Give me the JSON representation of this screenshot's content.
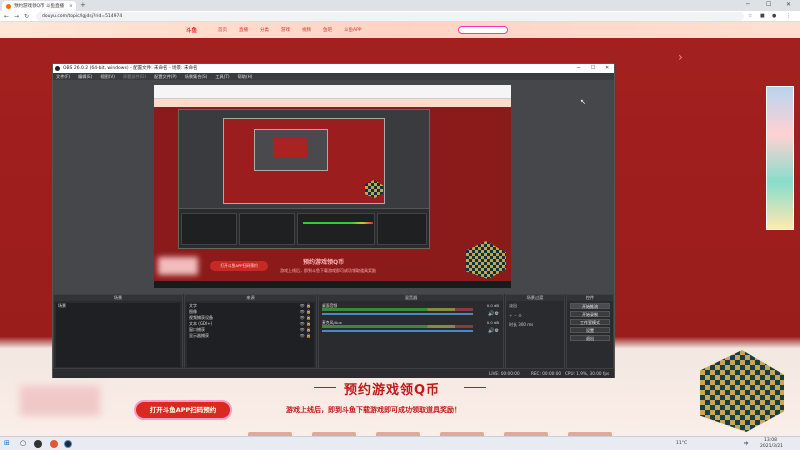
{
  "browser": {
    "tab_title": "预约游戏领Q币 斗鱼直播",
    "tab_close": "×",
    "new_tab": "+",
    "minimize": "─",
    "maximize": "☐",
    "close": "✕",
    "address": "douyu.com/topic/lgjdsj?rid=514974",
    "back": "←",
    "forward": "→",
    "reload": "↻",
    "star": "☆"
  },
  "site": {
    "logo": "斗鱼",
    "nav": [
      "首页",
      "直播",
      "分类",
      "游戏",
      "视频",
      "鱼吧",
      "斗鱼APP"
    ],
    "banner_title": "预约游戏领Q币",
    "banner_sub": "游戏上线后，即到斗鱼下载游戏即可成功领取道具奖励！",
    "app_button": "打开斗鱼APP扫码预约"
  },
  "obs": {
    "title": "OBS 26.0.2 (64-bit, windows) - 配置文件: 未命名 - 场景: 未命名",
    "menu": [
      "文件(F)",
      "编辑(E)",
      "视图(V)",
      "停靠部件(D)",
      "配置文件(P)",
      "场景集合(S)",
      "工具(T)",
      "帮助(H)"
    ],
    "canvas": {
      "banner": "预约游戏领Q币",
      "subtitle": "游戏上线后，即到斗鱼下载游戏即可成功领取道具奖励",
      "button": "打开斗鱼APP扫码预约"
    },
    "docks": {
      "scenes": {
        "header": "场景",
        "items": [
          "场景"
        ],
        "footer": "+ − ∧ ∨"
      },
      "sources": {
        "header": "来源",
        "items": [
          "文字",
          "图像",
          "视频捕获设备",
          "文本 (GDI+)",
          "窗口捕获",
          "显示器捕获"
        ],
        "footer": "+ − ⚙ ∧ ∨"
      },
      "mixer": {
        "header": "混音器",
        "tracks": [
          {
            "name": "桌面音频",
            "db": "0.0 dB"
          },
          {
            "name": "麦克风/Aux",
            "db": "0.0 dB"
          }
        ]
      },
      "transitions": {
        "header": "场景过渡",
        "type": "淡出",
        "duration_label": "时长",
        "duration": "300 ms"
      },
      "controls": {
        "header": "控件",
        "buttons": [
          "开始推流",
          "开始录制",
          "工作室模式",
          "设置",
          "退出"
        ]
      }
    },
    "status": {
      "live": "LIVE: 00:00:00",
      "rec": "REC: 00:00:00",
      "cpu": "CPU: 1.9%, 30.00 fps"
    }
  },
  "taskbar": {
    "start": "⊞",
    "search": "○",
    "weather": "11°C",
    "time": "13:08",
    "date": "2021/3/21",
    "lang": "中"
  }
}
